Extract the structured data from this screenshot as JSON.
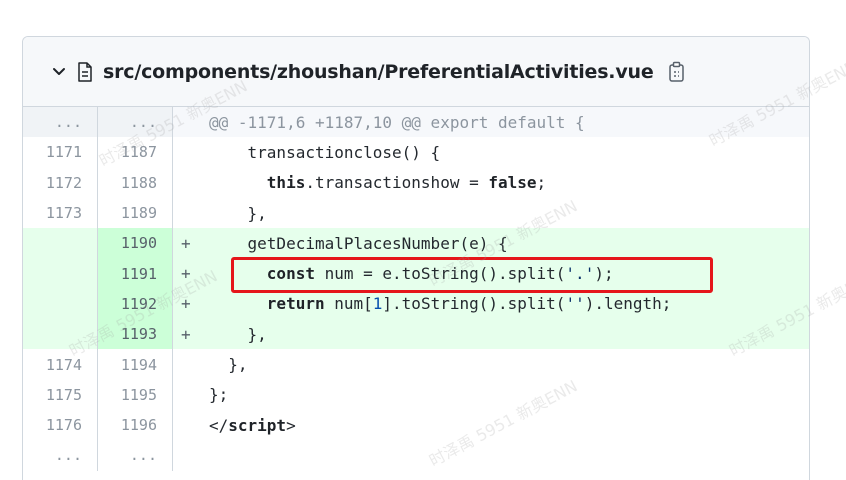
{
  "file": {
    "path": "src/components/zhoushan/PreferentialActivities.vue"
  },
  "icons": {
    "collapse": "chevron-down-icon",
    "file": "file-icon",
    "copy": "copy-path-icon"
  },
  "colors": {
    "added_bg": "#e6ffec",
    "added_num_bg": "#ccffd8",
    "hunk_bg": "#f6f8fb",
    "highlight_border": "#e5161b"
  },
  "diff": {
    "hunk_header": "@@ -1171,6 +1187,10 @@ export default {",
    "expander": "...",
    "lines": [
      {
        "old": "1171",
        "new": "1187",
        "marker": "",
        "text": "    transactionclose() {"
      },
      {
        "old": "1172",
        "new": "1188",
        "marker": "",
        "text_kw1": "this",
        "text_mid": ".transactionshow = ",
        "text_kw2": "false",
        "text_end": ";"
      },
      {
        "old": "1173",
        "new": "1189",
        "marker": "",
        "text": "    },"
      },
      {
        "old": "",
        "new": "1190",
        "marker": "+",
        "text": "    getDecimalPlacesNumber(e) {"
      },
      {
        "old": "",
        "new": "1191",
        "marker": "+",
        "text_kw1": "const",
        "text_mid": " num = e.toString().split(",
        "text_str": "'.'",
        "text_end": ");"
      },
      {
        "old": "",
        "new": "1192",
        "marker": "+",
        "text_kw1": "return",
        "text_mid": " num[",
        "text_num": "1",
        "text_mid2": "].toString().split(",
        "text_str": "''",
        "text_end": ").length;"
      },
      {
        "old": "",
        "new": "1193",
        "marker": "+",
        "text": "    },"
      },
      {
        "old": "1174",
        "new": "1194",
        "marker": "",
        "text": "  },"
      },
      {
        "old": "1175",
        "new": "1195",
        "marker": "",
        "text": "};"
      },
      {
        "old": "1176",
        "new": "1196",
        "marker": "",
        "text_tag_open": "</",
        "text_kw1": "script",
        "text_tag_close": ">"
      }
    ]
  },
  "watermark": "时泽禹 5951 新奥ENN"
}
